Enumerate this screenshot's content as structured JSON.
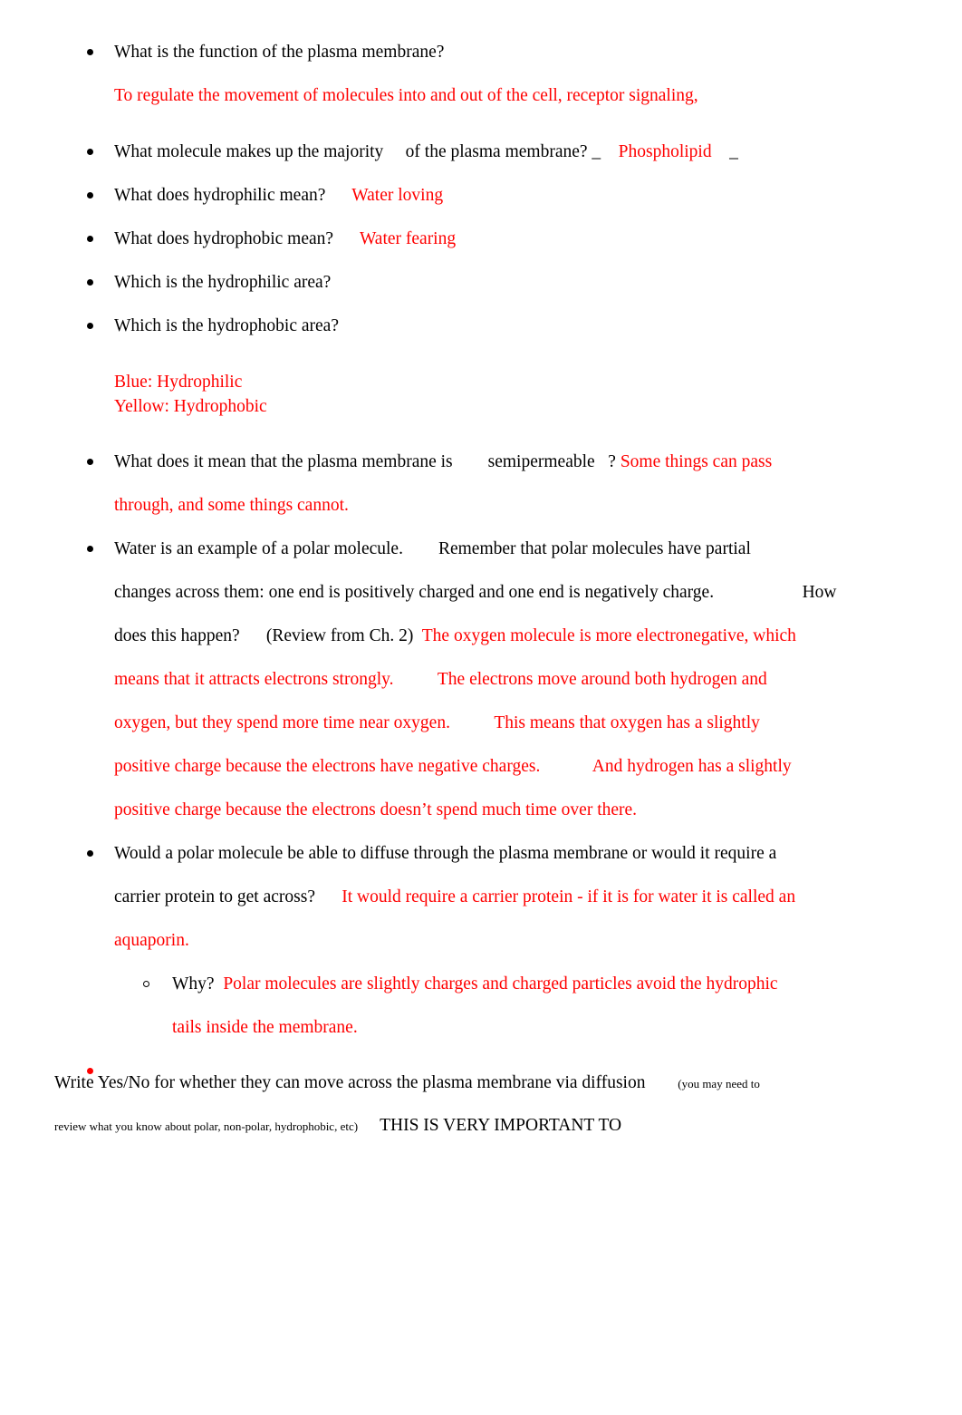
{
  "document": {
    "text_color_black": "#000000",
    "text_color_red": "#ff0000",
    "q1": {
      "question": "What is the function of the plasma membrane?",
      "answer": "To regulate the movement of molecules into and out of the cell, receptor signaling,"
    },
    "q2": {
      "part1": "What molecule makes up the majority",
      "part2": "     of the plasma membrane? _",
      "answer": "    Phospholipid",
      "trailing": "    _"
    },
    "q3": {
      "question": "What does hydrophilic mean?",
      "answer": "      Water loving"
    },
    "q4": {
      "question": "What does hydrophobic mean?",
      "answer": "      Water fearing"
    },
    "q5": {
      "question": "Which is the hydrophilic area?"
    },
    "q6": {
      "question": "Which is the hydrophobic area?"
    },
    "color_key": {
      "line1": "Blue: Hydrophilic",
      "line2": "Yellow: Hydrophobic"
    },
    "q7": {
      "part1": "What does it mean that the plasma membrane is",
      "part2": "        semipermeable   ?",
      "answer_line1": " Some things can pass",
      "answer_line2": "through, and some things cannot."
    },
    "q8": {
      "line1": "Water is an example of a polar molecule.        Remember that polar molecules have partial",
      "line2": "changes across them: one end is positively charged and one end is negatively charge.                    How",
      "line3_black": "does this happen?      (Review from Ch. 2)",
      "line3_red": "  The oxygen molecule is more electronegative, which",
      "line4_red": "means that it attracts electrons strongly.          The electrons move around both hydrogen and",
      "line5_red": "oxygen, but they spend more time near oxygen.          This means that oxygen has a slightly",
      "line6_red": "positive charge because the electrons have negative charges.            And hydrogen has a slightly",
      "line7_red": "positive charge because the electrons doesn’t spend much time over there."
    },
    "q9": {
      "line1": "Would a polar molecule be able to diffuse through the plasma membrane or would it require a",
      "line2_black": "carrier protein to get across?",
      "line2_red": "      It would require a carrier protein - if it is for water it is called an",
      "line3_red": "aquaporin.",
      "sub": {
        "question": "Why?",
        "answer_line1": "  Polar molecules are slightly charges and charged particles avoid the hydrophic",
        "answer_line2": "tails inside the membrane."
      }
    },
    "empty_red_bullet": {
      "marker": "red-filled-bullet"
    },
    "footer": {
      "line1_main": "Write Yes/No for whether they can move across the plasma membrane via diffusion",
      "line1_small": "           (you may need to",
      "line2_small": "review what you know about polar, non-polar, hydrophobic, etc)",
      "line2_main": "     THIS IS VERY IMPORTANT TO"
    }
  }
}
